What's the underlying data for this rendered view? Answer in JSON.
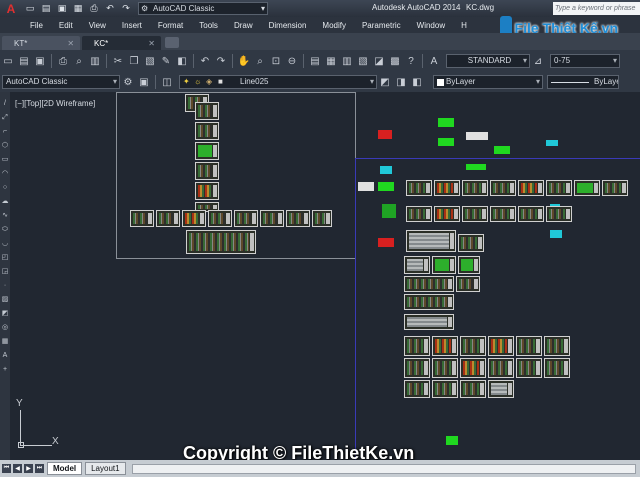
{
  "titlebar": {
    "app_logo": "A",
    "workspace": "AutoCAD Classic",
    "app_title": "Autodesk AutoCAD 2014",
    "file_title": "KC.dwg",
    "search_placeholder": "Type a keyword or phrase",
    "quick_access_icons": [
      "new-icon",
      "open-icon",
      "save-icon",
      "saveas-icon",
      "print-icon",
      "undo-icon",
      "redo-icon"
    ]
  },
  "menu": [
    "File",
    "Edit",
    "View",
    "Insert",
    "Format",
    "Tools",
    "Draw",
    "Dimension",
    "Modify",
    "Parametric",
    "Window",
    "H"
  ],
  "watermark": {
    "logo_text": "File Thiết Kế.vn",
    "copyright": "Copyright © FileThietKe.vn"
  },
  "file_tabs": [
    {
      "label": "KT*",
      "active": false
    },
    {
      "label": "KC*",
      "active": true
    }
  ],
  "toolbar": {
    "text_style": "STANDARD",
    "dim_scale": "0-75",
    "workspace": "AutoCAD Classic",
    "layer": "Line025",
    "color": "ByLayer",
    "linetype": "ByLayer"
  },
  "viewport": {
    "label": "[−][Top][2D Wireframe]"
  },
  "ucs": {
    "x_label": "X",
    "y_label": "Y"
  },
  "layout_tabs": [
    {
      "label": "Model",
      "active": true
    },
    {
      "label": "Layout1",
      "active": false
    }
  ],
  "colors": {
    "background": "#212731",
    "viewport_blue": "#3a3ab8",
    "accent_red": "#e03030",
    "object_green": "#20d820"
  }
}
